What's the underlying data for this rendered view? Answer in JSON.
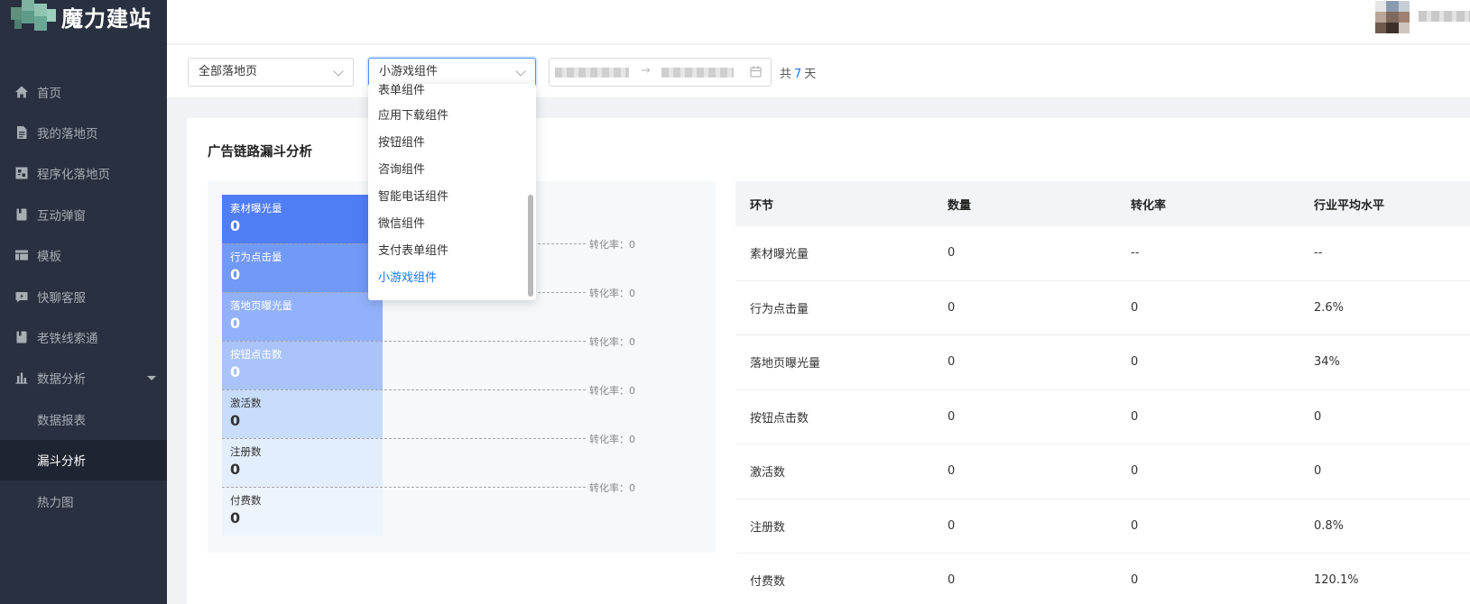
{
  "app": {
    "logo_text": "魔力建站"
  },
  "sidebar": {
    "items": [
      {
        "label": "首页",
        "icon": "home-icon"
      },
      {
        "label": "我的落地页",
        "icon": "document-icon"
      },
      {
        "label": "程序化落地页",
        "icon": "program-icon"
      },
      {
        "label": "互动弹窗",
        "icon": "popup-icon"
      },
      {
        "label": "模板",
        "icon": "template-icon"
      },
      {
        "label": "快聊客服",
        "icon": "chat-icon"
      },
      {
        "label": "老铁线索通",
        "icon": "leads-icon"
      },
      {
        "label": "数据分析",
        "icon": "bar-chart-icon",
        "expanded": true
      }
    ],
    "subitems": [
      {
        "label": "数据报表",
        "active": false
      },
      {
        "label": "漏斗分析",
        "active": true
      },
      {
        "label": "热力图",
        "active": false
      }
    ]
  },
  "filters": {
    "landing_page": "全部落地页",
    "component": "小游戏组件",
    "total_prefix": "共",
    "total_days": "7",
    "total_suffix": "天",
    "range_arrow": "→"
  },
  "dropdown": {
    "options": [
      {
        "label": "表单组件",
        "selected": false
      },
      {
        "label": "应用下载组件",
        "selected": false
      },
      {
        "label": "按钮组件",
        "selected": false
      },
      {
        "label": "咨询组件",
        "selected": false
      },
      {
        "label": "智能电话组件",
        "selected": false
      },
      {
        "label": "微信组件",
        "selected": false
      },
      {
        "label": "支付表单组件",
        "selected": false
      },
      {
        "label": "小游戏组件",
        "selected": true
      }
    ]
  },
  "funnel": {
    "title": "广告链路漏斗分析",
    "steps": [
      {
        "label": "素材曝光量",
        "value": "0",
        "color": "#4e7df6"
      },
      {
        "label": "行为点击量",
        "value": "0",
        "color": "#7199f8"
      },
      {
        "label": "落地页曝光量",
        "value": "0",
        "color": "#92b1fa"
      },
      {
        "label": "按钮点击数",
        "value": "0",
        "color": "#aac4fb"
      },
      {
        "label": "激活数",
        "value": "0",
        "color": "#c8ddfb"
      },
      {
        "label": "注册数",
        "value": "0",
        "color": "#e2eefb"
      },
      {
        "label": "付费数",
        "value": "0",
        "color": "#edf4fc"
      }
    ],
    "rates": [
      "转化率：0",
      "转化率：0",
      "转化率：0",
      "转化率：0",
      "转化率：0",
      "转化率：0"
    ]
  },
  "table": {
    "headers": [
      "环节",
      "数量",
      "转化率",
      "行业平均水平"
    ],
    "rows": [
      [
        "素材曝光量",
        "0",
        "--",
        "--"
      ],
      [
        "行为点击量",
        "0",
        "0",
        "2.6%"
      ],
      [
        "落地页曝光量",
        "0",
        "0",
        "34%"
      ],
      [
        "按钮点击数",
        "0",
        "0",
        "0"
      ],
      [
        "激活数",
        "0",
        "0",
        "0"
      ],
      [
        "注册数",
        "0",
        "0",
        "0.8%"
      ],
      [
        "付费数",
        "0",
        "0",
        "120.1%"
      ]
    ]
  }
}
